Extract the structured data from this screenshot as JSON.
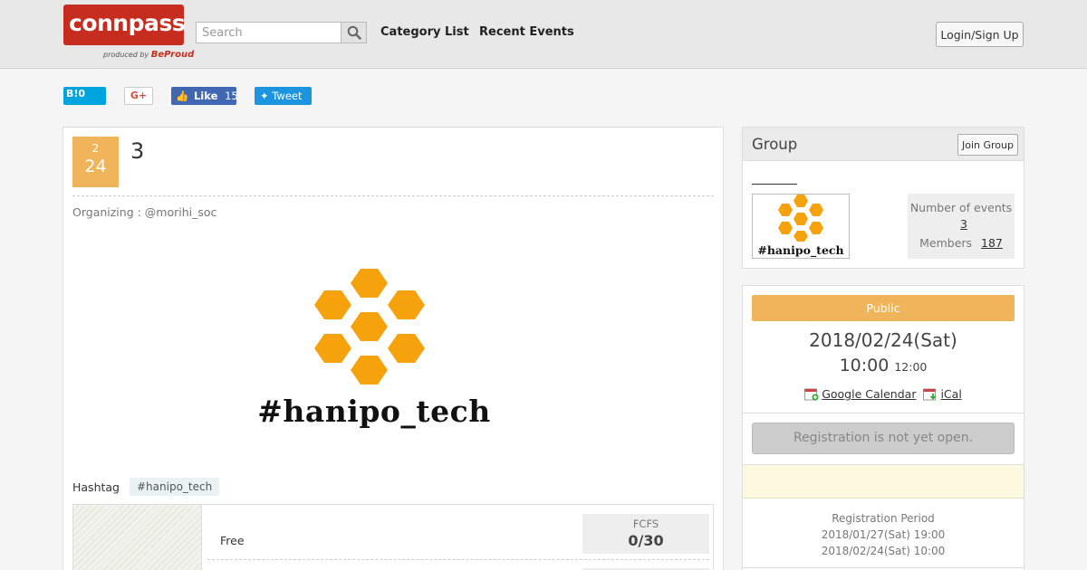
{
  "header": {
    "logo_text": "connpass",
    "logo_sub_prefix": "produced by",
    "logo_sub_brand": "BeProud",
    "search_placeholder": "Search",
    "nav": [
      "Category List",
      "Recent Events"
    ],
    "login_label": "Login/Sign Up"
  },
  "social": {
    "hatena_label": "B!",
    "hatena_count": "0",
    "gplus_label": "G+",
    "fb_label": "Like",
    "fb_count": "15",
    "tweet_label": "Tweet"
  },
  "event": {
    "month": "2",
    "day": "24",
    "title": "3",
    "organizer": "Organizing : @morihi_soc",
    "hero_text": "#hanipo_tech",
    "hashtag_label": "Hashtag",
    "hashtag": "#hanipo_tech",
    "ticket": {
      "name": "Free",
      "type": "FCFS",
      "capacity": "0/30"
    }
  },
  "group": {
    "title": "Group",
    "join_label": "Join Group",
    "logo_text": "#hanipo_tech",
    "events_label": "Number of events",
    "events_count": "3",
    "members_label": "Members",
    "members_count": "187"
  },
  "info": {
    "status": "Public",
    "date": "2018/02/24(Sat)",
    "start_time": "10:00",
    "end_time": "12:00",
    "google_calendar": "Google Calendar",
    "ical": "iCal",
    "registration_button": "Registration is not yet open.",
    "period_label": "Registration Period",
    "period_start": "2018/01/27(Sat) 19:00",
    "period_end": "2018/02/24(Sat) 10:00"
  },
  "colors": {
    "brand_red": "#c62d1f",
    "accent_orange": "#f0b45a",
    "honeycomb": "#f5a20d"
  }
}
